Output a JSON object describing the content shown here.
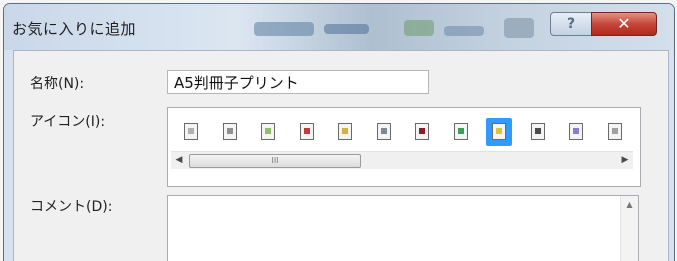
{
  "window": {
    "title": "お気に入りに追加",
    "help_glyph": "?",
    "close_glyph": "✕"
  },
  "form": {
    "name_label": "名称(N):",
    "name_value": "A5判冊子プリント",
    "icon_label": "アイコン(I):",
    "comment_label": "コメント(D):",
    "comment_value": ""
  },
  "icons": [
    {
      "name": "doc-plain-icon",
      "accent": "#b0b0b0"
    },
    {
      "name": "doc-lines-icon",
      "accent": "#909090"
    },
    {
      "name": "doc-green-icon",
      "accent": "#8fbf6a"
    },
    {
      "name": "doc-red-icon",
      "accent": "#c33a3a"
    },
    {
      "name": "doc-yellow-icon",
      "accent": "#d6b23a"
    },
    {
      "name": "doc-gray-icon",
      "accent": "#7d8a96"
    },
    {
      "name": "doc-dark-red-icon",
      "accent": "#8a1e2a"
    },
    {
      "name": "doc-image-icon",
      "accent": "#3aa05a"
    },
    {
      "name": "doc-selected-icon",
      "accent": "#e0c040",
      "selected": true
    },
    {
      "name": "doc-dark-icon",
      "accent": "#4a4a4a"
    },
    {
      "name": "doc-purple-icon",
      "accent": "#8a7ad0"
    },
    {
      "name": "doc-partial-icon",
      "accent": "#a0a0a0"
    }
  ],
  "scrollbar": {
    "left_glyph": "◀",
    "right_glyph": "▶",
    "thumb_grip": "III",
    "up_glyph": "▲"
  },
  "colors": {
    "selection": "#3399ff",
    "close_button": "#c6473a",
    "title_bar": "#c9d8e9"
  }
}
